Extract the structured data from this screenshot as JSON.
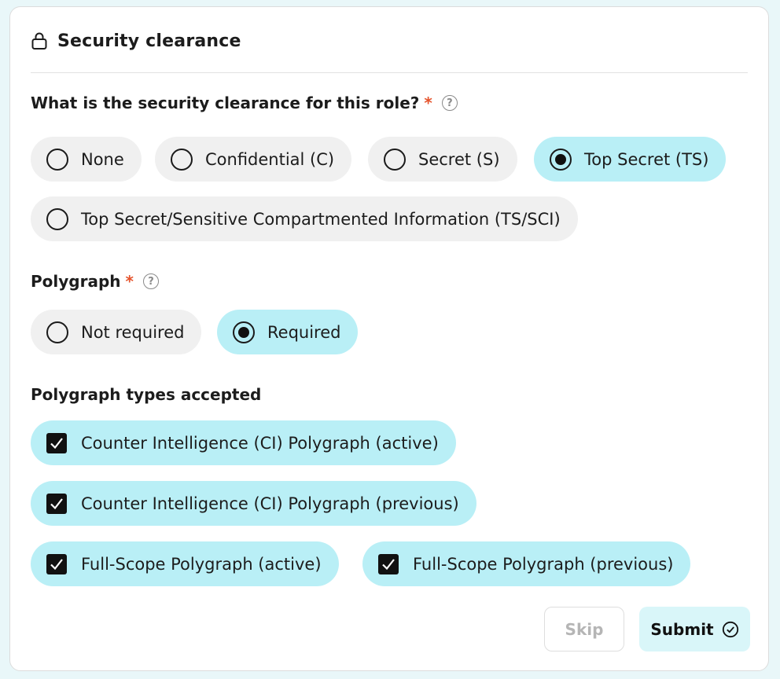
{
  "section": {
    "title": "Security clearance",
    "icon": "lock-icon"
  },
  "clearance": {
    "question": "What is the security clearance for this role?",
    "required_mark": "*",
    "help_glyph": "?",
    "options": [
      {
        "label": "None",
        "selected": false
      },
      {
        "label": "Confidential (C)",
        "selected": false
      },
      {
        "label": "Secret (S)",
        "selected": false
      },
      {
        "label": "Top Secret (TS)",
        "selected": true
      },
      {
        "label": "Top Secret/Sensitive Compartmented Information (TS/SCI)",
        "selected": false
      }
    ]
  },
  "polygraph": {
    "question": "Polygraph",
    "required_mark": "*",
    "help_glyph": "?",
    "options": [
      {
        "label": "Not required",
        "selected": false
      },
      {
        "label": "Required",
        "selected": true
      }
    ]
  },
  "polygraph_types": {
    "question": "Polygraph types accepted",
    "options": [
      {
        "label": "Counter Intelligence (CI) Polygraph (active)",
        "checked": true
      },
      {
        "label": "Counter Intelligence (CI) Polygraph (previous)",
        "checked": true
      },
      {
        "label": "Full-Scope Polygraph (active)",
        "checked": true
      },
      {
        "label": "Full-Scope Polygraph (previous)",
        "checked": true
      }
    ]
  },
  "actions": {
    "skip_label": "Skip",
    "submit_label": "Submit"
  },
  "colors": {
    "selected_bg": "#b9eff6",
    "unselected_bg": "#f0f0f0",
    "required": "#e5532c",
    "page_bg": "#e9f7f9"
  }
}
